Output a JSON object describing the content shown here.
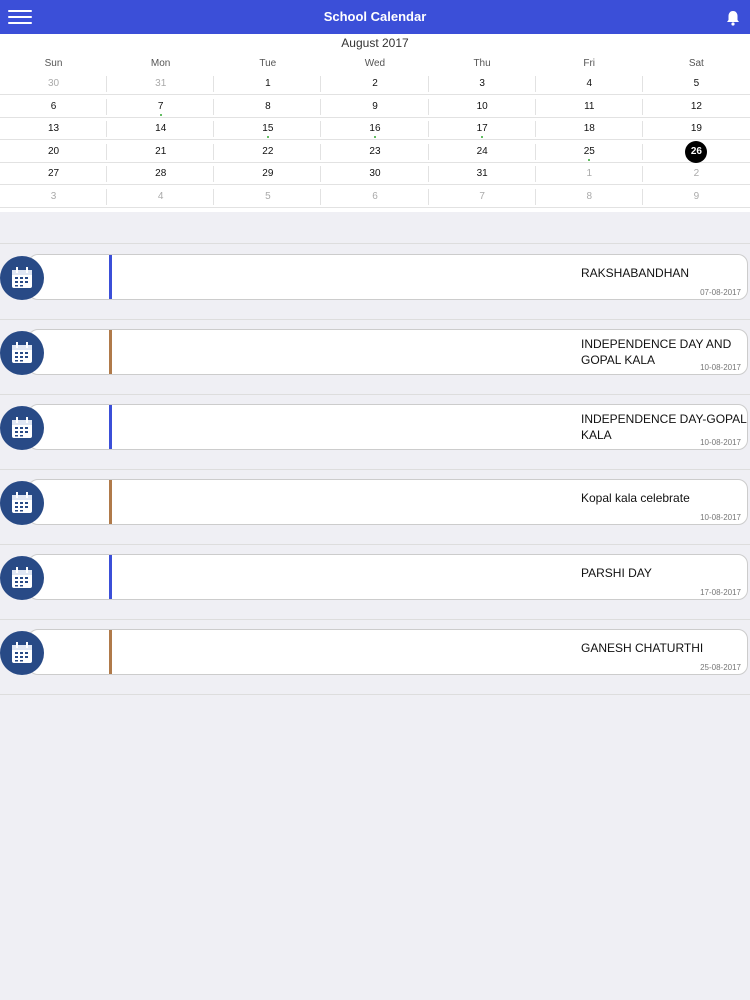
{
  "header": {
    "title": "School Calendar"
  },
  "calendar": {
    "month_label": "August 2017",
    "days_of_week": [
      "Sun",
      "Mon",
      "Tue",
      "Wed",
      "Thu",
      "Fri",
      "Sat"
    ],
    "weeks": [
      [
        "30",
        "31",
        "1",
        "2",
        "3",
        "4",
        "5"
      ],
      [
        "6",
        "7",
        "8",
        "9",
        "10",
        "11",
        "12"
      ],
      [
        "13",
        "14",
        "15",
        "16",
        "17",
        "18",
        "19"
      ],
      [
        "20",
        "21",
        "22",
        "23",
        "24",
        "25",
        "26"
      ],
      [
        "27",
        "28",
        "29",
        "30",
        "31",
        "1",
        "2"
      ],
      [
        "3",
        "4",
        "5",
        "6",
        "7",
        "8",
        "9"
      ]
    ],
    "selected_day": "26",
    "event_days": [
      "7",
      "15",
      "16",
      "17",
      "25"
    ]
  },
  "events": [
    {
      "title": "RAKSHABANDHAN",
      "date": "07-08-2017",
      "bar_color": "#3b4fd8"
    },
    {
      "title": "INDEPENDENCE DAY AND GOPAL KALA",
      "date": "10-08-2017",
      "bar_color": "#b07a4a"
    },
    {
      "title": "INDEPENDENCE DAY-GOPAL KALA",
      "date": "10-08-2017",
      "bar_color": "#3b4fd8"
    },
    {
      "title": "Kopal kala celebrate",
      "date": "10-08-2017",
      "bar_color": "#b07a4a"
    },
    {
      "title": "PARSHI DAY",
      "date": "17-08-2017",
      "bar_color": "#3b4fd8"
    },
    {
      "title": "GANESH CHATURTHI",
      "date": "25-08-2017",
      "bar_color": "#b07a4a"
    }
  ],
  "colors": {
    "header": "#3b4fd8",
    "icon_circle": "#284a86",
    "accent_blue": "#3b4fd8",
    "accent_brown": "#b07a4a"
  },
  "icons": {
    "menu": "hamburger-icon",
    "bell": "bell-icon",
    "event": "calendar-icon"
  }
}
